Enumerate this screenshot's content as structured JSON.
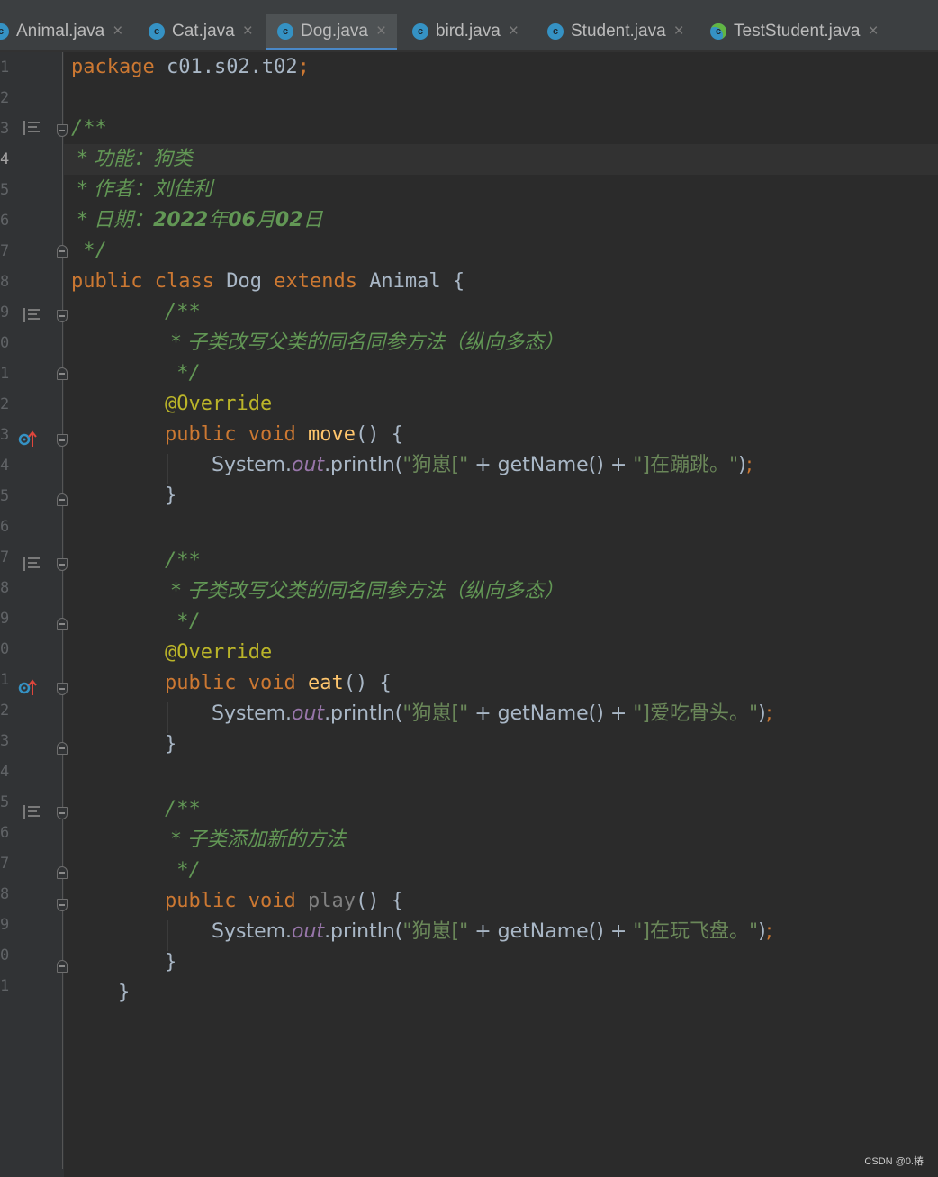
{
  "tabs": [
    {
      "label": "Animal.java"
    },
    {
      "label": "Cat.java"
    },
    {
      "label": "Dog.java"
    },
    {
      "label": "bird.java"
    },
    {
      "label": "Student.java"
    },
    {
      "label": "TestStudent.java"
    }
  ],
  "tab_icon_letter": "c",
  "tab_close": "×",
  "active_tab": "Dog.java",
  "line_numbers": [
    "1",
    "2",
    "3",
    "4",
    "5",
    "6",
    "7",
    "8",
    "9",
    "0",
    "1",
    "2",
    "3",
    "4",
    "5",
    "6",
    "7",
    "8",
    "9",
    "0",
    "1",
    "2",
    "3",
    "4",
    "5",
    "6",
    "7",
    "8",
    "9",
    "0",
    "1"
  ],
  "current_line": "4",
  "code": {
    "l1_kw": "package",
    "l1_rest": " c01.s02.t02",
    "l1_semi": ";",
    "l3": "/**",
    "l4": " * 功能：狗类",
    "l5": " * 作者：刘佳利",
    "l6_a": " * 日期：",
    "l6_b": "2022",
    "l6_c": "年",
    "l6_d": "06",
    "l6_e": "月",
    "l6_f": "02",
    "l6_g": "日",
    "l7": " */",
    "l8_public": "public",
    "l8_class": "class",
    "l8_name": "Dog",
    "l8_extends": "extends",
    "l8_parent": "Animal",
    "l8_brace": "{",
    "l9": "/**",
    "l10": " * 子类改写父类的同名同参方法（纵向多态）",
    "l11": " */",
    "l12": "@Override",
    "l13_public": "public",
    "l13_void": "void",
    "l13_name": "move",
    "l13_rest": "() {",
    "l14_sys": "System.",
    "l14_out": "out",
    "l14_call": ".println(",
    "l14_s1": "\"狗崽[\"",
    "l14_mid": " + getName() + ",
    "l14_s2": "\"]在蹦跳。\"",
    "l14_end": ")",
    "l14_semi": ";",
    "l15": "}",
    "l17": "/**",
    "l18": " * 子类改写父类的同名同参方法（纵向多态）",
    "l19": " */",
    "l20": "@Override",
    "l21_public": "public",
    "l21_void": "void",
    "l21_name": "eat",
    "l21_rest": "() {",
    "l22_sys": "System.",
    "l22_out": "out",
    "l22_call": ".println(",
    "l22_s1": "\"狗崽[\"",
    "l22_mid": " + getName() + ",
    "l22_s2": "\"]爱吃骨头。\"",
    "l22_end": ")",
    "l22_semi": ";",
    "l23": "}",
    "l25": "/**",
    "l26": " * 子类添加新的方法",
    "l27": " */",
    "l28_public": "public",
    "l28_void": "void",
    "l28_name": "play",
    "l28_rest": "() {",
    "l29_sys": "System.",
    "l29_out": "out",
    "l29_call": ".println(",
    "l29_s1": "\"狗崽[\"",
    "l29_mid": " + getName() + ",
    "l29_s2": "\"]在玩飞盘。\"",
    "l29_end": ")",
    "l29_semi": ";",
    "l30": "}",
    "l31": "}"
  },
  "watermark": "CSDN @0.椿",
  "colors": {
    "background": "#2b2b2b",
    "gutter": "#313335",
    "keyword": "#cc7832",
    "comment": "#629755",
    "annotation": "#bbb529",
    "method": "#ffc66d",
    "string": "#6a8759",
    "field": "#9876aa",
    "text": "#a9b7c6",
    "tab_active_underline": "#4a88c7"
  }
}
